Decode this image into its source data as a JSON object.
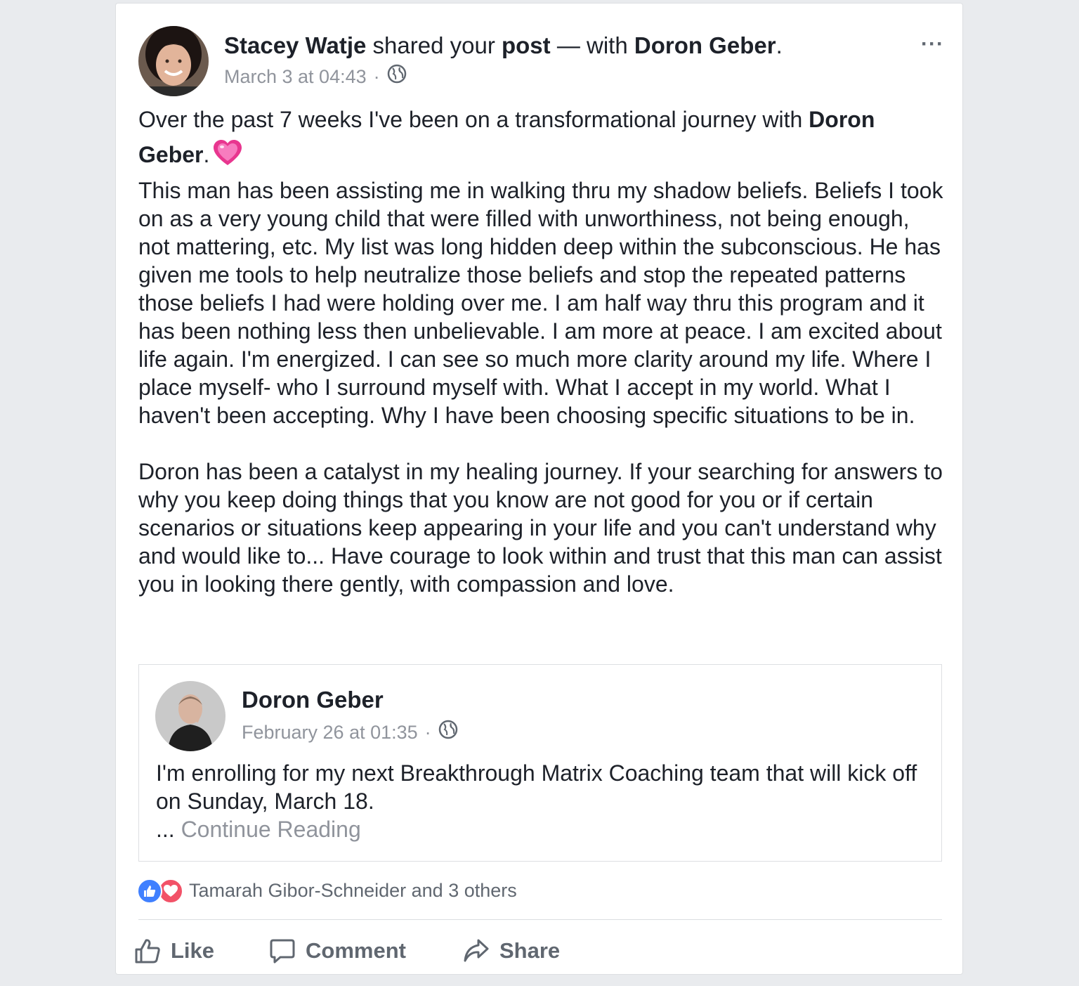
{
  "post": {
    "author": "Stacey Watje",
    "action_text": "shared your",
    "object": "post",
    "with_text": "— with",
    "tagged": "Doron Geber",
    "period": ".",
    "timestamp": "March 3 at 04:43",
    "dot": "·",
    "privacy_icon": "globe-icon",
    "more_label": "···",
    "body": {
      "intro_before": "Over the past 7 weeks I've been on a transformational journey with",
      "intro_tag": "Doron Geber",
      "intro_after": ".",
      "emoji": "sparkling-heart-emoji",
      "paragraph1": "This man has been assisting me in walking thru my shadow beliefs. Beliefs I took on as a very young child that were filled with unworthiness, not being enough, not mattering, etc. My list was long hidden deep within the subconscious. He has given me tools to help neutralize those beliefs and stop the repeated patterns those beliefs I had were holding over me. I am half way thru this program and it has been nothing less then unbelievable. I am more at peace. I am excited about life again. I'm energized. I can see so much more clarity around my life. Where I place myself- who I surround myself with. What I accept in my world. What I haven't been accepting. Why I have been choosing specific situations to be in.",
      "paragraph2": "Doron has been a catalyst in my healing journey. If your searching for answers to why you keep doing things that you know are not good for you or if certain scenarios or situations keep appearing in your life and you can't understand why and would like to... Have courage to look within and trust that this man can assist you in looking there gently, with compassion and love."
    }
  },
  "shared_post": {
    "author": "Doron Geber",
    "timestamp": "February 26 at 01:35",
    "dot": "·",
    "privacy_icon": "globe-icon",
    "text": "I'm enrolling for my next Breakthrough Matrix Coaching team that will kick off on Sunday, March 18.",
    "ellipsis": "...",
    "continue_label": "Continue Reading"
  },
  "reactions": {
    "icons": [
      "like-reaction-icon",
      "love-reaction-icon"
    ],
    "summary": "Tamarah Gibor-Schneider and 3 others"
  },
  "actions": {
    "like": "Like",
    "comment": "Comment",
    "share": "Share"
  },
  "colors": {
    "page_bg": "#e9ebee",
    "like_blue": "#4080ff",
    "love_red": "#f25268",
    "muted": "#90949c",
    "action_gray": "#606770"
  }
}
